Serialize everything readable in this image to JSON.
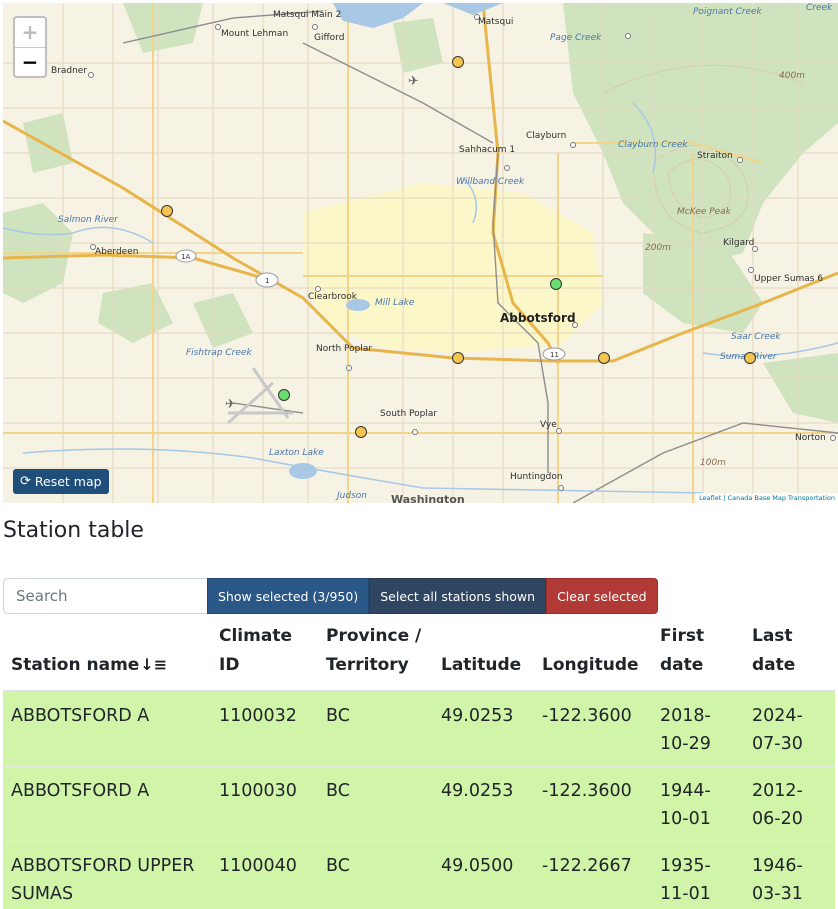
{
  "map": {
    "zoom_in_label": "+",
    "zoom_out_label": "−",
    "reset_label": "Reset map",
    "attribution": "Leaflet | Canada Base Map Transportation",
    "places": [
      "Matsqui Main 2",
      "Mount Lehman",
      "Gifford",
      "Matsqui",
      "Bradner",
      "Sahhacum 1",
      "Clayburn",
      "Straiton",
      "Aberdeen",
      "Kilgard",
      "Upper Sumas 6",
      "Clearbrook",
      "Abbotsford",
      "North Poplar",
      "South Poplar",
      "Vye",
      "Norton",
      "Huntingdon",
      "Washington"
    ],
    "water_features": [
      "Poignant Creek",
      "Creek",
      "Page Creek",
      "Clayburn Creek",
      "Willband Creek",
      "Salmon River",
      "Mill Lake",
      "Fishtrap Creek",
      "Saar Creek",
      "Sumas River",
      "Laxton Lake",
      "Judson"
    ],
    "terrain_features": [
      "400m",
      "McKee Peak",
      "200m",
      "100m"
    ],
    "highway_shields": [
      "1A",
      "1",
      "11"
    ],
    "station_markers": [
      {
        "status": "unselected",
        "color": "#f5c550"
      },
      {
        "status": "unselected",
        "color": "#f5c550"
      },
      {
        "status": "selected",
        "color": "#66e070"
      },
      {
        "status": "unselected",
        "color": "#f5c550"
      },
      {
        "status": "unselected",
        "color": "#f5c550"
      },
      {
        "status": "unselected",
        "color": "#f5c550"
      },
      {
        "status": "selected",
        "color": "#66e070"
      },
      {
        "status": "unselected",
        "color": "#f5c550"
      }
    ]
  },
  "station_table": {
    "title": "Station table",
    "search_placeholder": "Search",
    "show_selected_label": "Show selected (3/950)",
    "select_all_label": "Select all stations shown",
    "clear_selected_label": "Clear selected",
    "columns": [
      "Station name",
      "Climate ID",
      "Province / Territory",
      "Latitude",
      "Longitude",
      "First date",
      "Last date"
    ],
    "sort_icon": "sort-alpha-down-icon",
    "selected_row_color": "#d0f5a8",
    "rows": [
      {
        "name": "ABBOTSFORD A",
        "climate_id": "1100032",
        "province": "BC",
        "latitude": "49.0253",
        "longitude": "-122.3600",
        "first_date": "2018-10-29",
        "last_date": "2024-07-30"
      },
      {
        "name": "ABBOTSFORD A",
        "climate_id": "1100030",
        "province": "BC",
        "latitude": "49.0253",
        "longitude": "-122.3600",
        "first_date": "1944-10-01",
        "last_date": "2012-06-20"
      },
      {
        "name": "ABBOTSFORD UPPER SUMAS",
        "climate_id": "1100040",
        "province": "BC",
        "latitude": "49.0500",
        "longitude": "-122.2667",
        "first_date": "1935-11-01",
        "last_date": "1946-03-31"
      }
    ]
  }
}
